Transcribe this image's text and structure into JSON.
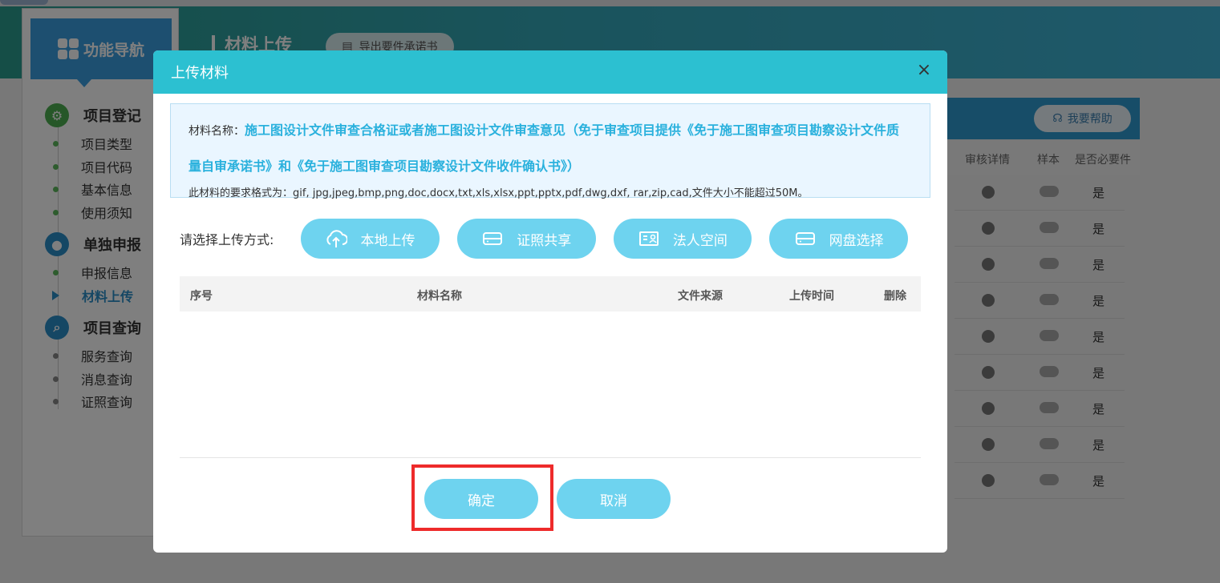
{
  "sidebar": {
    "nav_title": "功能导航",
    "sections": [
      {
        "title": "项目登记",
        "items": [
          "项目类型",
          "项目代码",
          "基本信息",
          "使用须知"
        ]
      },
      {
        "title": "单独申报",
        "items": [
          "申报信息",
          "材料上传"
        ]
      },
      {
        "title": "项目查询",
        "items": [
          "服务查询",
          "消息查询",
          "证照查询"
        ]
      }
    ],
    "active_item": "材料上传"
  },
  "page": {
    "title": "材料上传",
    "export_label": "导出要件承诺书",
    "help_label": "我要帮助",
    "columns": [
      "审核详情",
      "样本",
      "是否必要件"
    ],
    "rows": [
      "是",
      "是",
      "是",
      "是",
      "是",
      "是",
      "是",
      "是",
      "是"
    ]
  },
  "modal": {
    "title": "上传材料",
    "close_symbol": "×",
    "material_label": "材料名称：",
    "material_name_line1": "施工图设计文件审查合格证或者施工图设计文件审查意见（免于审查项目提供《免于施工图审查项目勘察设计文件质",
    "material_name_line2": "量自审承诺书》和《免于施工图审查项目勘察设计文件收件确认书》）",
    "format_text": "此材料的要求格式为：gif, jpg,jpeg,bmp,png,doc,docx,txt,xls,xlsx,ppt,pptx,pdf,dwg,dxf, rar,zip,cad,文件大小不能超过50M。",
    "upload_label": "请选择上传方式:",
    "upload_buttons": [
      {
        "label": "本地上传",
        "icon": "cloud-upload-icon"
      },
      {
        "label": "证照共享",
        "icon": "drive-icon"
      },
      {
        "label": "法人空间",
        "icon": "id-card-icon"
      },
      {
        "label": "网盘选择",
        "icon": "drive-icon"
      }
    ],
    "table_headers": [
      "序号",
      "材料名称",
      "文件来源",
      "上传时间",
      "删除"
    ],
    "confirm_label": "确定",
    "cancel_label": "取消"
  },
  "colors": {
    "modal_header": "#2cc0d1",
    "button": "#6ed3ef",
    "highlight": "#ee2b2b",
    "material_name": "#2ab1dd"
  }
}
